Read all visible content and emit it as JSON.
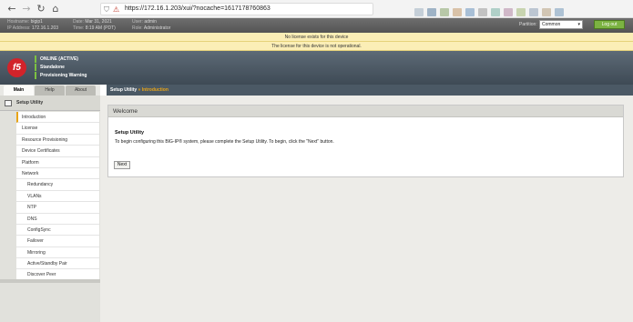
{
  "browser": {
    "url": "https://172.16.1.203/xui/?nocache=1617178760863"
  },
  "system_info": {
    "hostname_label": "Hostname:",
    "hostname": "bigip1",
    "ip_label": "IP Address:",
    "ip": "172.16.1.203",
    "date_label": "Date:",
    "date": "Mar 31, 2021",
    "time_label": "Time:",
    "time": "8:19 AM (PDT)",
    "user_label": "User:",
    "user": "admin",
    "role_label": "Role:",
    "role": "Administrator",
    "partition_label": "Partition:",
    "partition_value": "Common",
    "logout_label": "Log out"
  },
  "notices": [
    "No license exists for this device",
    "The license for this device is not operational."
  ],
  "logo_text": "f5",
  "status": [
    "ONLINE (ACTIVE)",
    "Standalone",
    "Provisioning Warning"
  ],
  "tabs": [
    {
      "label": "Main"
    },
    {
      "label": "Help"
    },
    {
      "label": "About"
    }
  ],
  "breadcrumb": {
    "section": "Setup Utility",
    "separator": "»",
    "current": "Introduction"
  },
  "sidebar": {
    "title": "Setup Utility",
    "items": [
      {
        "label": "Introduction"
      },
      {
        "label": "License"
      },
      {
        "label": "Resource Provisioning"
      },
      {
        "label": "Device Certificates"
      },
      {
        "label": "Platform"
      },
      {
        "label": "Network"
      },
      {
        "label": "Redundancy"
      },
      {
        "label": "VLANs"
      },
      {
        "label": "NTP"
      },
      {
        "label": "DNS"
      },
      {
        "label": "ConfigSync"
      },
      {
        "label": "Failover"
      },
      {
        "label": "Mirroring"
      },
      {
        "label": "Active/Standby Pair"
      },
      {
        "label": "Discover Peer"
      }
    ]
  },
  "welcome": {
    "title": "Welcome",
    "subtitle": "Setup Utility",
    "text": "To begin configuring this BIG-IP® system, please complete the Setup Utility. To begin, click the \"Next\" button.",
    "next_label": "Next"
  },
  "colors": {
    "accent": "#e8a417",
    "status_green": "#7cc142",
    "logo_red": "#d2232a",
    "notice_yellow": "#fbeeb6"
  }
}
